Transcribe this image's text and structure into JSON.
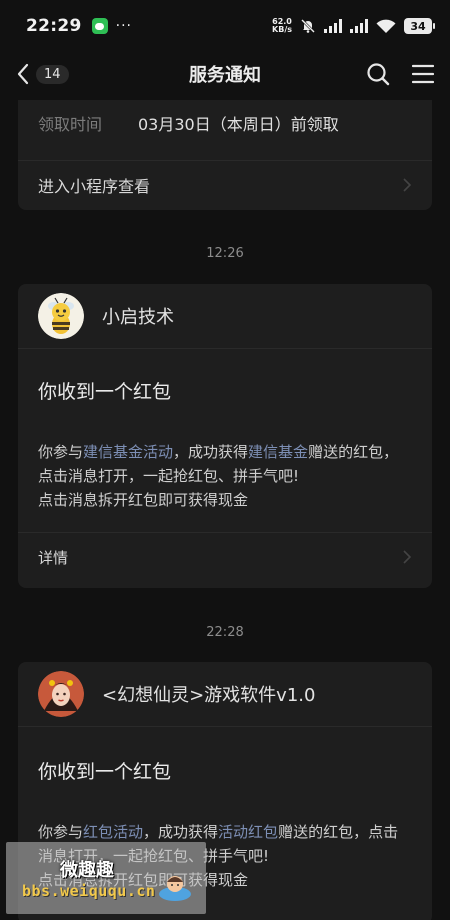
{
  "status_bar": {
    "time": "22:29",
    "more": "···",
    "net_speed_value": "62.0",
    "net_speed_unit": "KB/s",
    "battery": "34"
  },
  "navbar": {
    "unread_count": "14",
    "title": "服务通知"
  },
  "card_top": {
    "claim_label": "领取时间",
    "claim_value": "03月30日（本周日）前领取",
    "mini_program_link": "进入小程序查看"
  },
  "messages": [
    {
      "time": "12:26",
      "sender": "小启技术",
      "title": "你收到一个红包",
      "body_line1_a": "你参与",
      "body_line1_hl1": "建信基金活动",
      "body_line1_b": "，成功获得",
      "body_line1_hl2": "建信基金",
      "body_line1_c": "赠送的红包，",
      "body_line2": "点击消息打开，一起抢红包、拼手气吧!",
      "body_line3": "点击消息拆开红包即可获得现金",
      "detail": "详情"
    },
    {
      "time": "22:28",
      "sender": "<幻想仙灵>游戏软件v1.0",
      "title": "你收到一个红包",
      "body_line1_a": "你参与",
      "body_line1_hl1": "红包活动",
      "body_line1_b": "，成功获得",
      "body_line1_hl2": "活动红包",
      "body_line1_c": "赠送的红包，点击",
      "body_line2": "消息打开，一起抢红包、拼手气吧!",
      "body_line3": "点击消息拆开红包即可获得现金"
    }
  ],
  "watermark": {
    "title": "微趣趣",
    "url": "bbs.weiququ.cn"
  },
  "colors": {
    "background": "#111111",
    "card": "#1e1e1e",
    "highlight": "#7d8fb5"
  }
}
